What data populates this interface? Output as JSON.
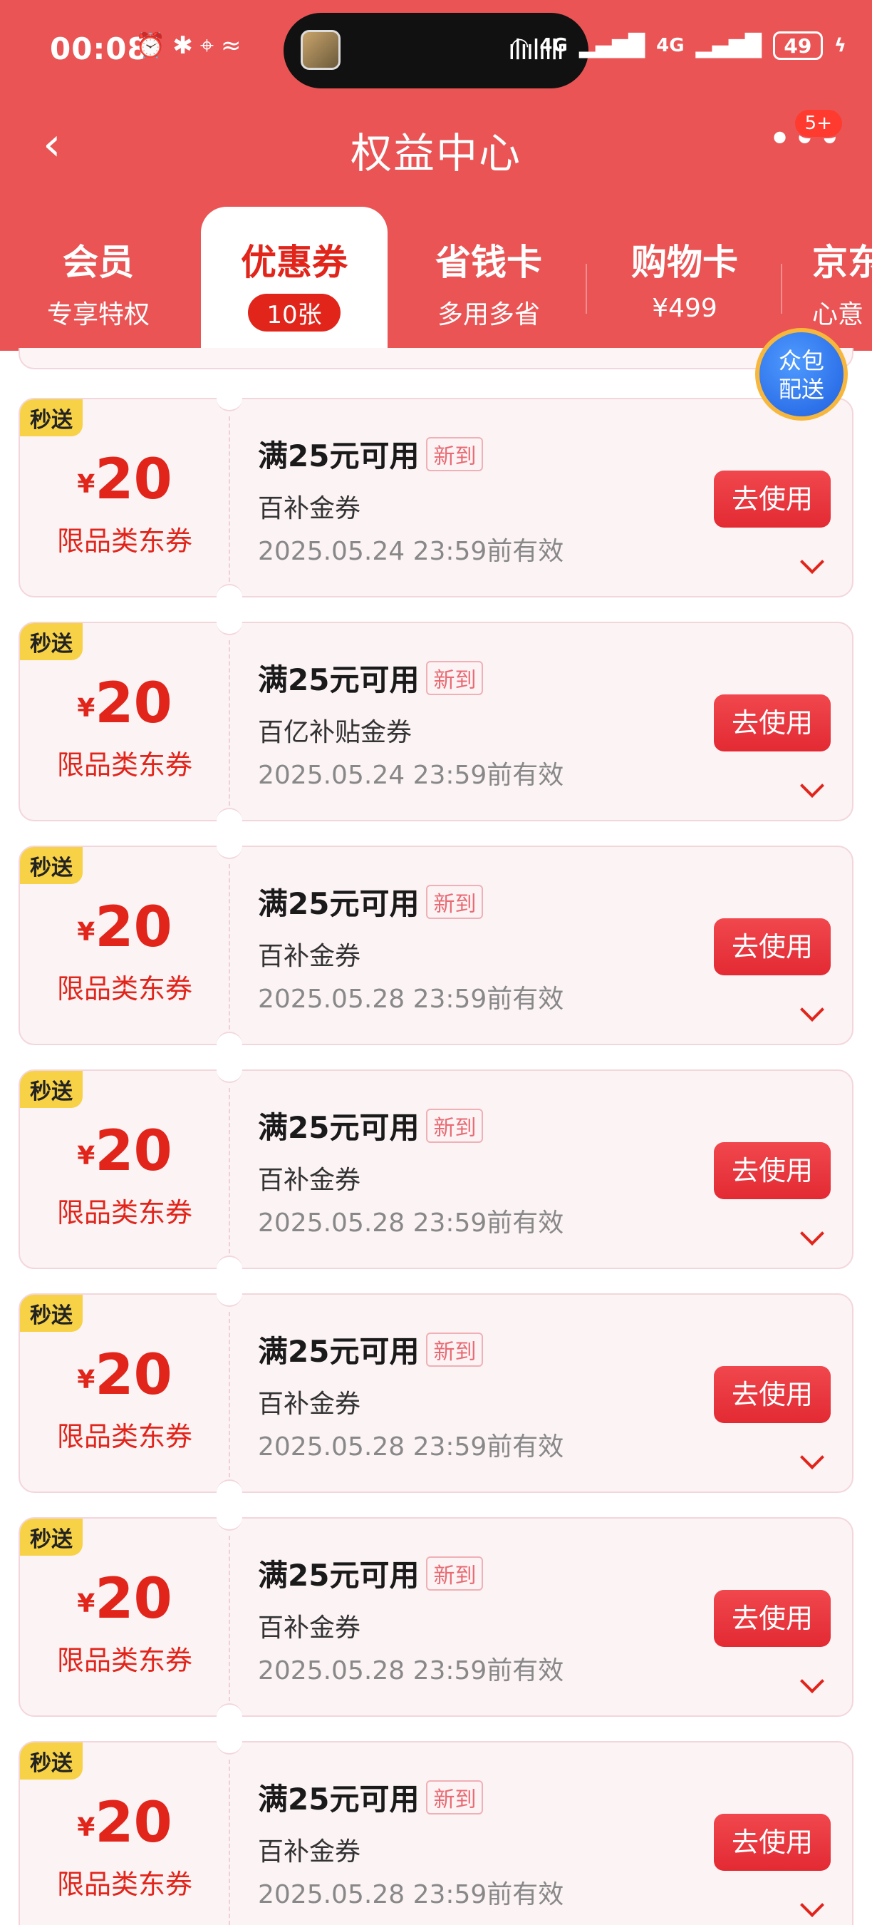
{
  "status_bar": {
    "time": "00:08",
    "left_icons": [
      "alarm-icon",
      "bluetooth-icon",
      "location-icon",
      "nfc-icon"
    ],
    "right_labels": [
      "4G",
      "4G"
    ],
    "battery": "49"
  },
  "nav": {
    "title": "权益中心",
    "back_icon": "back-icon",
    "more_icon": "more-icon",
    "badge": "5+"
  },
  "tabs": [
    {
      "title": "会员",
      "sub": "专享特权"
    },
    {
      "title": "优惠券",
      "badge": "10张"
    },
    {
      "title": "省钱卡",
      "sub": "多用多省"
    },
    {
      "title": "购物卡",
      "sub": "¥499"
    },
    {
      "title": "京东",
      "sub": "心意"
    }
  ],
  "float_button": {
    "line1": "众包",
    "line2": "配送"
  },
  "coupons": [
    {
      "tag": "秒送",
      "currency": "¥",
      "amount": "20",
      "limit": "限品类东券",
      "condition": "满25元可用",
      "new_tag": "新到",
      "name": "百补金券",
      "valid": "2025.05.24 23:59前有效",
      "button": "去使用"
    },
    {
      "tag": "秒送",
      "currency": "¥",
      "amount": "20",
      "limit": "限品类东券",
      "condition": "满25元可用",
      "new_tag": "新到",
      "name": "百亿补贴金券",
      "valid": "2025.05.24 23:59前有效",
      "button": "去使用"
    },
    {
      "tag": "秒送",
      "currency": "¥",
      "amount": "20",
      "limit": "限品类东券",
      "condition": "满25元可用",
      "new_tag": "新到",
      "name": "百补金券",
      "valid": "2025.05.28 23:59前有效",
      "button": "去使用"
    },
    {
      "tag": "秒送",
      "currency": "¥",
      "amount": "20",
      "limit": "限品类东券",
      "condition": "满25元可用",
      "new_tag": "新到",
      "name": "百补金券",
      "valid": "2025.05.28 23:59前有效",
      "button": "去使用"
    },
    {
      "tag": "秒送",
      "currency": "¥",
      "amount": "20",
      "limit": "限品类东券",
      "condition": "满25元可用",
      "new_tag": "新到",
      "name": "百补金券",
      "valid": "2025.05.28 23:59前有效",
      "button": "去使用"
    },
    {
      "tag": "秒送",
      "currency": "¥",
      "amount": "20",
      "limit": "限品类东券",
      "condition": "满25元可用",
      "new_tag": "新到",
      "name": "百补金券",
      "valid": "2025.05.28 23:59前有效",
      "button": "去使用"
    },
    {
      "tag": "秒送",
      "currency": "¥",
      "amount": "20",
      "limit": "限品类东券",
      "condition": "满25元可用",
      "new_tag": "新到",
      "name": "百补金券",
      "valid": "2025.05.28 23:59前有效",
      "button": "去使用"
    }
  ],
  "colors": {
    "header_bg": "#ea5455",
    "accent": "#e1251b",
    "tag_bg": "#f7d146",
    "coupon_bg": "#fcf3f5"
  }
}
